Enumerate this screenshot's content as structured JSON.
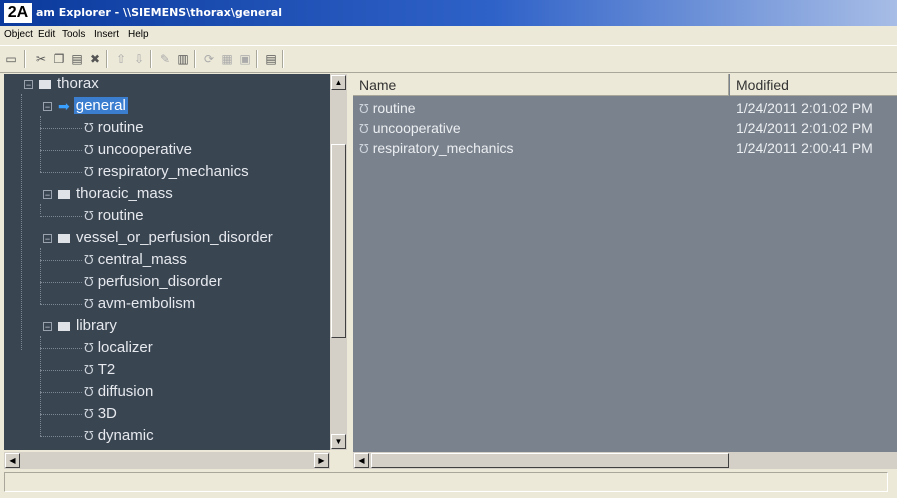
{
  "figure_label": "2A",
  "window_title": "am Explorer - \\\\SIEMENS\\thorax\\general",
  "menu": [
    "Object",
    "Edit",
    "Tools",
    "Insert",
    "Help"
  ],
  "tree": [
    {
      "label": "thorax",
      "level": 0,
      "type": "folder",
      "expanded": true
    },
    {
      "label": "general",
      "level": 1,
      "type": "current",
      "expanded": true,
      "selected": true
    },
    {
      "label": "routine",
      "level": 2,
      "type": "protocol"
    },
    {
      "label": "uncooperative",
      "level": 2,
      "type": "protocol"
    },
    {
      "label": "respiratory_mechanics",
      "level": 2,
      "type": "protocol"
    },
    {
      "label": "thoracic_mass",
      "level": 1,
      "type": "folder",
      "expanded": true
    },
    {
      "label": "routine",
      "level": 2,
      "type": "protocol"
    },
    {
      "label": "vessel_or_perfusion_disorder",
      "level": 1,
      "type": "folder",
      "expanded": true
    },
    {
      "label": "central_mass",
      "level": 2,
      "type": "protocol"
    },
    {
      "label": "perfusion_disorder",
      "level": 2,
      "type": "protocol"
    },
    {
      "label": "avm-embolism",
      "level": 2,
      "type": "protocol"
    },
    {
      "label": "library",
      "level": 1,
      "type": "folder",
      "expanded": true
    },
    {
      "label": "localizer",
      "level": 2,
      "type": "protocol"
    },
    {
      "label": "T2",
      "level": 2,
      "type": "protocol"
    },
    {
      "label": "diffusion",
      "level": 2,
      "type": "protocol"
    },
    {
      "label": "3D",
      "level": 2,
      "type": "protocol"
    },
    {
      "label": "dynamic",
      "level": 2,
      "type": "protocol"
    }
  ],
  "list": {
    "columns": [
      "Name",
      "Modified"
    ],
    "rows": [
      {
        "name": "routine",
        "modified": "1/24/2011 2:01:02 PM"
      },
      {
        "name": "uncooperative",
        "modified": "1/24/2011 2:01:02 PM"
      },
      {
        "name": "respiratory_mechanics",
        "modified": "1/24/2011 2:00:41 PM"
      }
    ]
  },
  "colors": {
    "tree_background": "#3a4552",
    "list_background": "#7a828d",
    "selection": "#3b7ed0",
    "title_bar": "#0b3a9c"
  }
}
